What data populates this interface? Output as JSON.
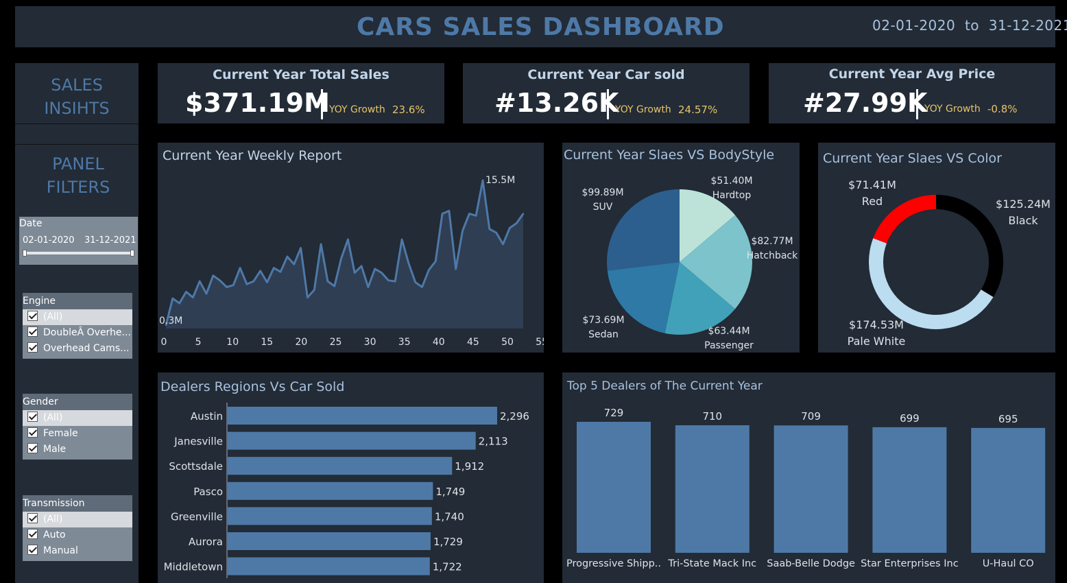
{
  "header": {
    "title": "CARS SALES DASHBOARD",
    "date_range": "02-01-2020  to  31-12-2021"
  },
  "sidebar": {
    "sales_insights": [
      "SALES",
      "INSIHTS"
    ],
    "panel_filters": [
      "PANEL",
      "FILTERS"
    ],
    "date_filter": {
      "label": "Date",
      "start": "02-01-2020",
      "end": "31-12-2021"
    },
    "filters": [
      {
        "label": "Engine",
        "items": [
          "(All)",
          "DoubleÂ Overhe...",
          "Overhead Cams..."
        ]
      },
      {
        "label": "Gender",
        "items": [
          "(All)",
          "Female",
          "Male"
        ]
      },
      {
        "label": "Transmission",
        "items": [
          "(All)",
          "Auto",
          "Manual"
        ]
      }
    ]
  },
  "kpis": [
    {
      "title": "Current Year Total Sales",
      "value": "$371.19M",
      "yoy_label": "YOY Growth",
      "yoy_value": "23.6%"
    },
    {
      "title": "Current Year Car sold",
      "value": "#13.26K",
      "yoy_label": "YOY Growth",
      "yoy_value": "24.57%"
    },
    {
      "title": "Current Year Avg Price",
      "value": "#27.99K",
      "yoy_label": "YOY Growth",
      "yoy_value": "-0.8%"
    }
  ],
  "colors": {
    "accent": "#4e79a7",
    "panel": "#222b36",
    "yoy": "#e8c468"
  },
  "chart_data": [
    {
      "type": "area",
      "title": "Current Year Weekly Report",
      "x_ticks": [
        "0",
        "5",
        "10",
        "15",
        "20",
        "25",
        "30",
        "35",
        "40",
        "45",
        "50",
        "55"
      ],
      "xlim": [
        0,
        53
      ],
      "ylim": [
        0.3,
        15.5
      ],
      "x": [
        0,
        1,
        2,
        3,
        4,
        5,
        6,
        7,
        8,
        9,
        10,
        11,
        12,
        13,
        14,
        15,
        16,
        17,
        18,
        19,
        20,
        21,
        22,
        23,
        24,
        25,
        26,
        27,
        28,
        29,
        30,
        31,
        32,
        33,
        34,
        35,
        36,
        37,
        38,
        39,
        40,
        41,
        42,
        43,
        44,
        45,
        46,
        47,
        48,
        49,
        50,
        51,
        52,
        53
      ],
      "values": [
        0.3,
        3.1,
        2.6,
        3.8,
        3.2,
        4.9,
        3.6,
        5.5,
        5.0,
        4.3,
        4.5,
        6.3,
        4.6,
        4.9,
        6.0,
        4.8,
        6.3,
        5.9,
        7.5,
        6.7,
        8.4,
        3.2,
        4.0,
        8.8,
        4.9,
        4.4,
        7.3,
        9.3,
        5.8,
        6.5,
        4.3,
        6.2,
        5.8,
        5.0,
        4.9,
        9.3,
        6.8,
        4.8,
        4.3,
        6.1,
        7.0,
        12.0,
        12.3,
        6.2,
        10.2,
        12.0,
        11.8,
        15.5,
        10.4,
        10.0,
        8.8,
        10.5,
        11.0,
        12.0
      ],
      "annotations": {
        "min": "0.3M",
        "max": "15.5M"
      },
      "series_color": "#4e79a7"
    },
    {
      "type": "pie",
      "title": "Current Year Slaes VS BodyStyle",
      "slices": [
        {
          "label": "Hardtop",
          "value": 51.4,
          "display": "$51.40M",
          "color": "#bde3d9"
        },
        {
          "label": "Hatchback",
          "value": 82.77,
          "display": "$82.77M",
          "color": "#7cc3cb"
        },
        {
          "label": "Passenger",
          "value": 63.44,
          "display": "$63.44M",
          "color": "#41a1b8"
        },
        {
          "label": "Sedan",
          "value": 73.69,
          "display": "$73.69M",
          "color": "#2e79a6"
        },
        {
          "label": "SUV",
          "value": 99.89,
          "display": "$99.89M",
          "color": "#2c5f8e"
        }
      ]
    },
    {
      "type": "pie",
      "donut": true,
      "title": "Current Year Slaes VS Color",
      "slices": [
        {
          "label": "Black",
          "value": 125.24,
          "display": "$125.24M",
          "color": "#000000"
        },
        {
          "label": "Pale White",
          "value": 174.53,
          "display": "$174.53M",
          "color": "#bcdcef"
        },
        {
          "label": "Red",
          "value": 71.41,
          "display": "$71.41M",
          "color": "#ff0000"
        }
      ]
    },
    {
      "type": "bar",
      "orientation": "horizontal",
      "title": "Dealers Regions Vs Car Sold",
      "categories": [
        "Austin",
        "Janesville",
        "Scottsdale",
        "Pasco",
        "Greenville",
        "Aurora",
        "Middletown"
      ],
      "values": [
        2296,
        2113,
        1912,
        1749,
        1740,
        1729,
        1722
      ],
      "labels": [
        "2,296",
        "2,113",
        "1,912",
        "1,749",
        "1,740",
        "1,729",
        "1,722"
      ],
      "xlim": [
        0,
        2296
      ],
      "color": "#4e79a7"
    },
    {
      "type": "bar",
      "orientation": "vertical",
      "title": "Top 5 Dealers of The Current Year",
      "categories": [
        "Progressive Shipp..",
        "Tri-State Mack Inc",
        "Saab-Belle Dodge",
        "Star Enterprises Inc",
        "U-Haul CO"
      ],
      "values": [
        729,
        710,
        709,
        699,
        695
      ],
      "labels": [
        "729",
        "710",
        "709",
        "699",
        "695"
      ],
      "ylim": [
        0,
        729
      ],
      "color": "#4e79a7"
    }
  ]
}
